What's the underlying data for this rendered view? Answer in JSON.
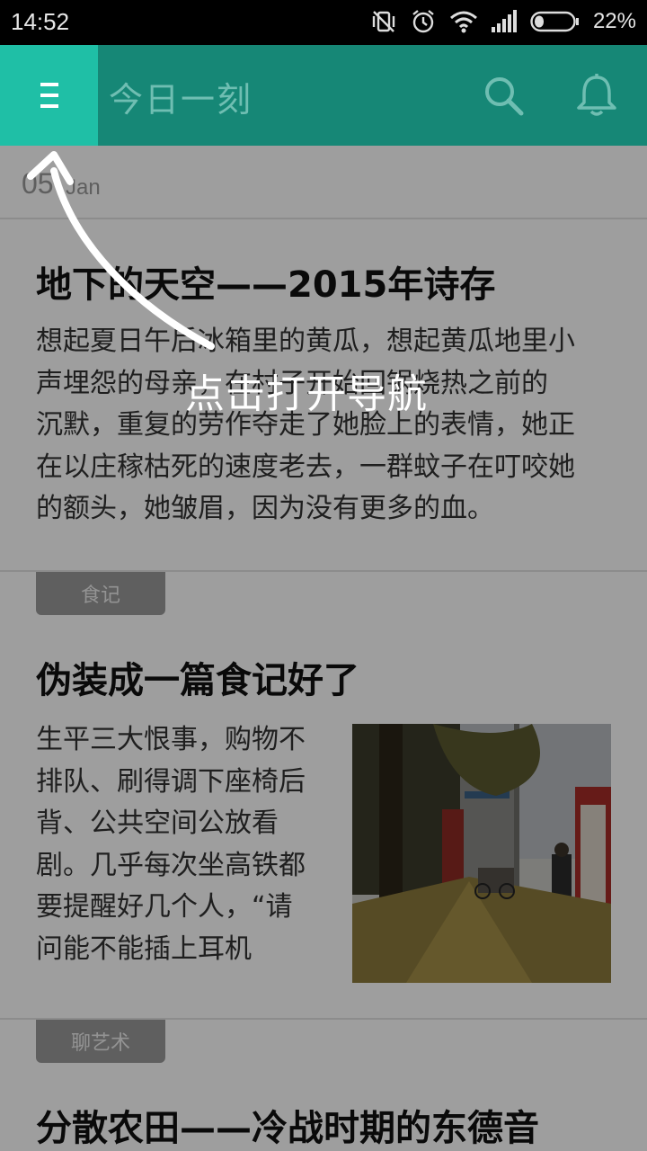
{
  "status_bar": {
    "time": "14:52",
    "battery_percent": "22%",
    "icons": [
      "vibrate-off-icon",
      "alarm-icon",
      "wifi-icon",
      "signal-icon",
      "battery-icon"
    ]
  },
  "app_bar": {
    "title": "今日一刻",
    "color": "#1a9a87",
    "menu_icon": "menu-icon",
    "search_icon": "search-icon",
    "bell_icon": "bell-icon"
  },
  "date": {
    "day": "05",
    "month": "Jan"
  },
  "articles": [
    {
      "title": "地下的天空——2015年诗存",
      "body_lines": [
        "想起夏日午后冰箱里的黄瓜，想起黄瓜地里小",
        "声埋怨的母亲，在村子开始回锅烧热之前的",
        "沉默，重复的劳作夺走了她脸上的表情，她正",
        "在以庄稼枯死的速度老去，一群蚊子在叮咬她",
        "的额头，她皱眉，因为没有更多的血。"
      ]
    },
    {
      "tag": "食记",
      "title": "伪装成一篇食记好了",
      "body_lines": [
        "生平三大恨事，购物不",
        "排队、刷得调下座椅后",
        "背、公共空间公放看",
        "剧。几乎每次坐高铁都",
        "要提醒好几个人，“请",
        "问能不能插上耳机"
      ]
    },
    {
      "tag": "聊艺术",
      "title": "分散农田——冷战时期的东德音"
    }
  ],
  "guide": {
    "text": "点击打开导航"
  }
}
